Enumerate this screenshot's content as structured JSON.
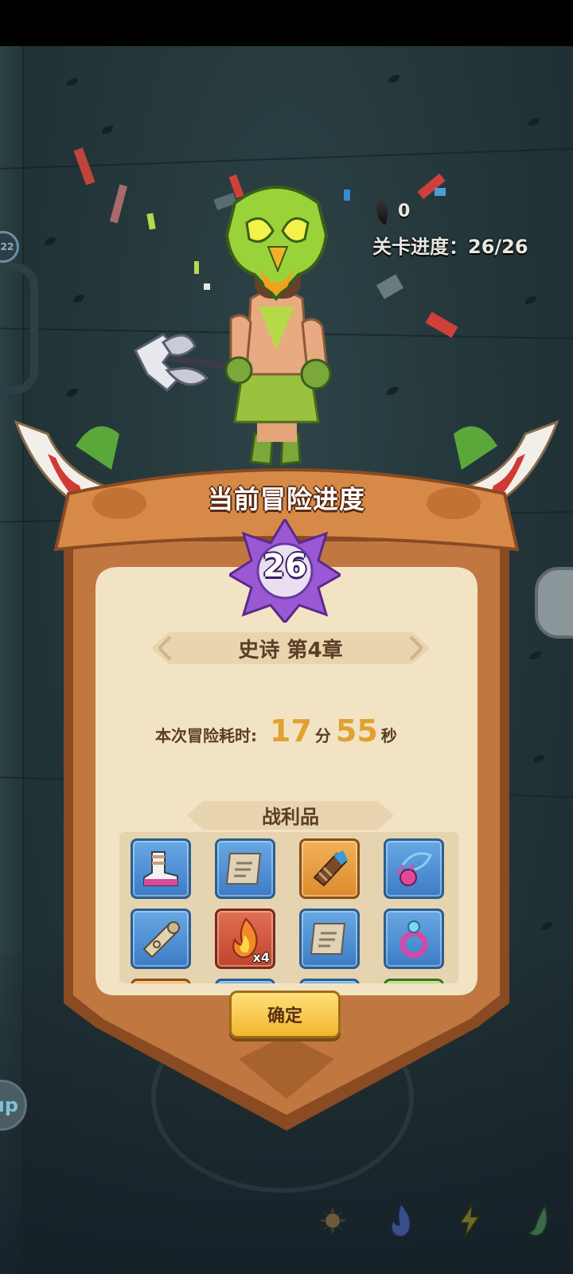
{
  "hud": {
    "rune_count": "0",
    "level_progress": "关卡进度：26/26",
    "left_badge": "22",
    "up_button_label": "up"
  },
  "result_panel": {
    "title": "当前冒险进度",
    "level_number": "26",
    "chapter": "史诗 第4章",
    "time_label": "本次冒险耗时:",
    "time_minutes": "17",
    "minutes_unit": "分",
    "time_seconds": "55",
    "seconds_unit": "秒",
    "loot_title": "战利品",
    "loot_items": [
      {
        "icon": "boots-icon",
        "rarity": "blue",
        "qty": ""
      },
      {
        "icon": "scroll-icon",
        "rarity": "blue",
        "qty": ""
      },
      {
        "icon": "bracer-icon",
        "rarity": "orange",
        "qty": ""
      },
      {
        "icon": "pendant-icon",
        "rarity": "blue",
        "qty": ""
      },
      {
        "icon": "rolled-scroll-icon",
        "rarity": "blue",
        "qty": ""
      },
      {
        "icon": "flame-icon",
        "rarity": "red",
        "qty": "x4"
      },
      {
        "icon": "scroll-icon",
        "rarity": "blue",
        "qty": ""
      },
      {
        "icon": "ring-icon",
        "rarity": "blue",
        "qty": ""
      }
    ],
    "confirm_label": "确定"
  },
  "skills": [
    "sun-skill-icon",
    "blue-flame-skill-icon",
    "lightning-skill-icon",
    "green-flame-skill-icon"
  ],
  "colors": {
    "wood": "#c07840",
    "parchment": "#f3e3c5",
    "gold_text": "#e0a132",
    "blue_rarity": "#3c7cc6",
    "orange_rarity": "#dc8a2b",
    "red_rarity": "#c0442c"
  }
}
